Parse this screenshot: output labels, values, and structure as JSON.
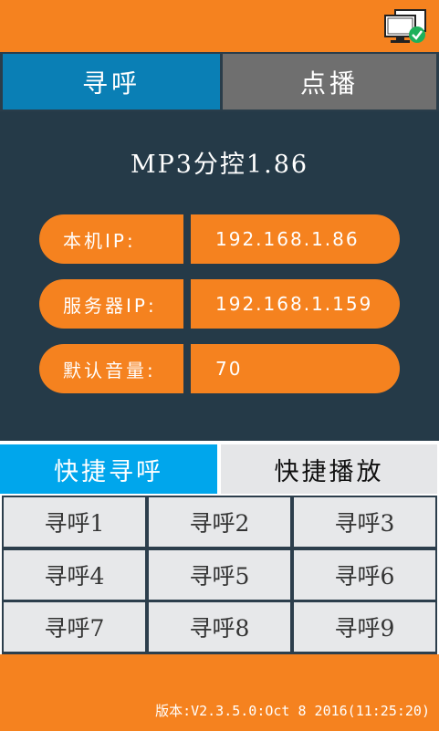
{
  "header": {
    "network_icon": "network-connected-icon"
  },
  "main_tabs": [
    {
      "label": "寻呼",
      "active": true
    },
    {
      "label": "点播",
      "active": false
    }
  ],
  "device": {
    "title": "MP3分控1.86",
    "fields": [
      {
        "label": "本机IP:",
        "value": "192.168.1.86"
      },
      {
        "label": "服务器IP:",
        "value": "192.168.1.159"
      },
      {
        "label": "默认音量:",
        "value": "70"
      }
    ]
  },
  "quick_tabs": [
    {
      "label": "快捷寻呼",
      "active": true
    },
    {
      "label": "快捷播放",
      "active": false
    }
  ],
  "quick_calls": [
    "寻呼1",
    "寻呼2",
    "寻呼3",
    "寻呼4",
    "寻呼5",
    "寻呼6",
    "寻呼7",
    "寻呼8",
    "寻呼9"
  ],
  "footer": {
    "version": "版本:V2.3.5.0:Oct 8 2016(11:25:20)"
  },
  "colors": {
    "accent": "#f5821f",
    "panel": "#253a48",
    "active_tab": "#0a7fb5",
    "inactive_tab": "#6f6f6f",
    "quick_active": "#00a6ec",
    "status_ok": "#1eb05a"
  }
}
